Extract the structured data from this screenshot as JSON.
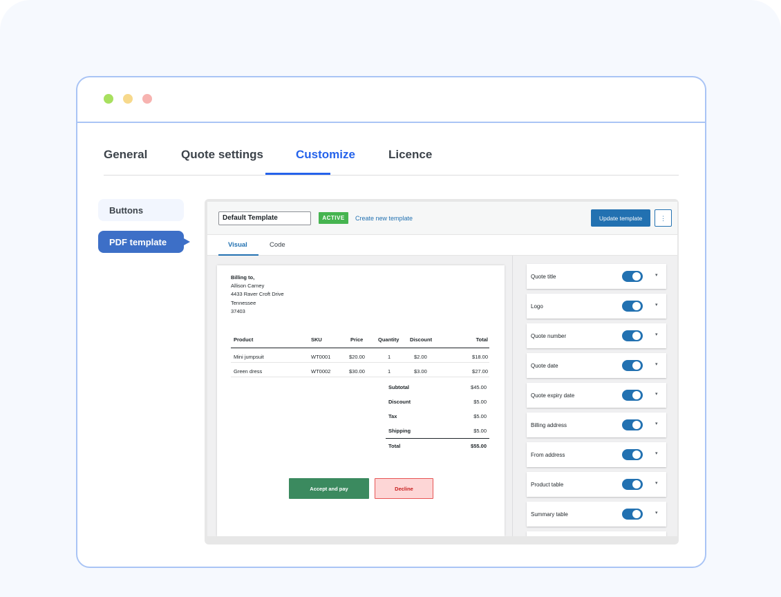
{
  "window": {
    "dots": [
      {
        "name": "green-dot",
        "color": "#a8e05f"
      },
      {
        "name": "yellow-dot",
        "color": "#f7d98c"
      },
      {
        "name": "red-dot",
        "color": "#f7b3b0"
      }
    ]
  },
  "tabs": [
    {
      "label": "General",
      "active": false
    },
    {
      "label": "Quote settings",
      "active": false
    },
    {
      "label": "Customize",
      "active": true
    },
    {
      "label": "Licence",
      "active": false
    }
  ],
  "sidebar": {
    "items": [
      {
        "label": "Buttons",
        "active": false
      },
      {
        "label": "PDF template",
        "active": true
      }
    ]
  },
  "editor": {
    "template_name": "Default Template",
    "status_badge": "ACTIVE",
    "create_link": "Create new template",
    "update_button": "Update template",
    "more_button": "⋮",
    "subtabs": [
      {
        "label": "Visual",
        "active": true
      },
      {
        "label": "Code",
        "active": false
      }
    ]
  },
  "document": {
    "billing": {
      "heading": "Billing to,",
      "name": "Allison Carney",
      "street": "4433 Raver Croft Drive",
      "state": "Tennessee",
      "zip": "37403"
    },
    "product_table": {
      "headers": [
        "Product",
        "SKU",
        "Price",
        "Quantity",
        "Discount",
        "Total"
      ],
      "rows": [
        [
          "Mini jumpsuit",
          "WT0001",
          "$20.00",
          "1",
          "$2.00",
          "$18.00"
        ],
        [
          "Green dress",
          "WT0002",
          "$30.00",
          "1",
          "$3.00",
          "$27.00"
        ]
      ]
    },
    "summary": [
      {
        "label": "Subtotal",
        "value": "$45.00"
      },
      {
        "label": "Discount",
        "value": "$5.00"
      },
      {
        "label": "Tax",
        "value": "$5.00"
      },
      {
        "label": "Shipping",
        "value": "$5.00"
      },
      {
        "label": "Total",
        "value": "$55.00"
      }
    ],
    "accept_button": "Accept and pay",
    "decline_button": "Decline"
  },
  "settings_panel": {
    "items": [
      {
        "label": "Quote title",
        "enabled": true
      },
      {
        "label": "Logo",
        "enabled": true
      },
      {
        "label": "Quote number",
        "enabled": true
      },
      {
        "label": "Quote date",
        "enabled": true
      },
      {
        "label": "Quote expiry date",
        "enabled": true
      },
      {
        "label": "Billing address",
        "enabled": true
      },
      {
        "label": "From address",
        "enabled": true
      },
      {
        "label": "Product table",
        "enabled": true
      },
      {
        "label": "Summary table",
        "enabled": true
      }
    ],
    "caret_icon": "▾"
  },
  "colors": {
    "accent": "#2563eb",
    "wp_blue": "#2271b1",
    "active_green": "#46b450",
    "accept_green": "#3b8a5f",
    "decline_red": "#c81e1e"
  }
}
